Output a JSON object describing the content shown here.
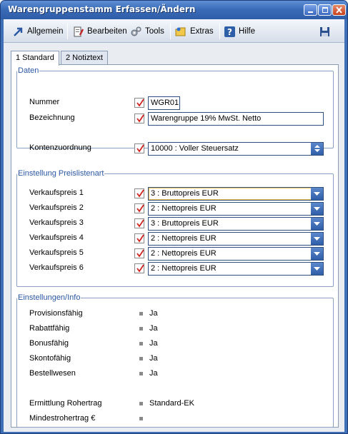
{
  "window": {
    "title": "Warengruppenstamm Erfassen/Ändern"
  },
  "colors": {
    "titlebar": "#3b6cb8",
    "accent": "#2b57a3",
    "check_red": "#d0201c",
    "dropdown": "#2f5ea8"
  },
  "toolbar": {
    "items": [
      {
        "label": "Allgemein",
        "icon": "arrow-icon"
      },
      {
        "label": "Bearbeiten",
        "icon": "edit-icon"
      },
      {
        "label": "Tools",
        "icon": "gears-icon"
      },
      {
        "label": "Extras",
        "icon": "folder-icon"
      },
      {
        "label": "Hilfe",
        "icon": "help-icon"
      }
    ],
    "save_icon": "floppy-disk-icon"
  },
  "tabs": [
    {
      "label": "1 Standard",
      "active": true
    },
    {
      "label": "2 Notiztext",
      "active": false
    }
  ],
  "daten": {
    "legend": "Daten",
    "nummer_label": "Nummer",
    "nummer_value": "WGR01",
    "bezeichnung_label": "Bezeichnung",
    "bezeichnung_value": "Warengruppe 19% MwSt. Netto",
    "konto_label": "Kontenzuordnung",
    "konto_value": "10000   : Voller Steuersatz"
  },
  "preisliste": {
    "legend": "Einstellung Preislistenart",
    "rows": [
      {
        "label": "Verkaufspreis 1",
        "value": "3 : Bruttopreis EUR"
      },
      {
        "label": "Verkaufspreis 2",
        "value": "2 : Nettopreis EUR"
      },
      {
        "label": "Verkaufspreis 3",
        "value": "3 : Bruttopreis EUR"
      },
      {
        "label": "Verkaufspreis 4",
        "value": "2 : Nettopreis EUR"
      },
      {
        "label": "Verkaufspreis 5",
        "value": "2 : Nettopreis EUR"
      },
      {
        "label": "Verkaufspreis 6",
        "value": "2 : Nettopreis EUR"
      }
    ]
  },
  "info": {
    "legend": "Einstellungen/Info",
    "rows": [
      {
        "label": "Provisionsfähig",
        "value": "Ja"
      },
      {
        "label": "Rabattfähig",
        "value": "Ja"
      },
      {
        "label": "Bonusfähig",
        "value": "Ja"
      },
      {
        "label": "Skontofähig",
        "value": "Ja"
      },
      {
        "label": "Bestellwesen",
        "value": "Ja"
      },
      {
        "label": "Ermittlung Rohertrag",
        "value": "Standard-EK"
      },
      {
        "label": "Mindestrohertrag €",
        "value": ""
      }
    ]
  }
}
